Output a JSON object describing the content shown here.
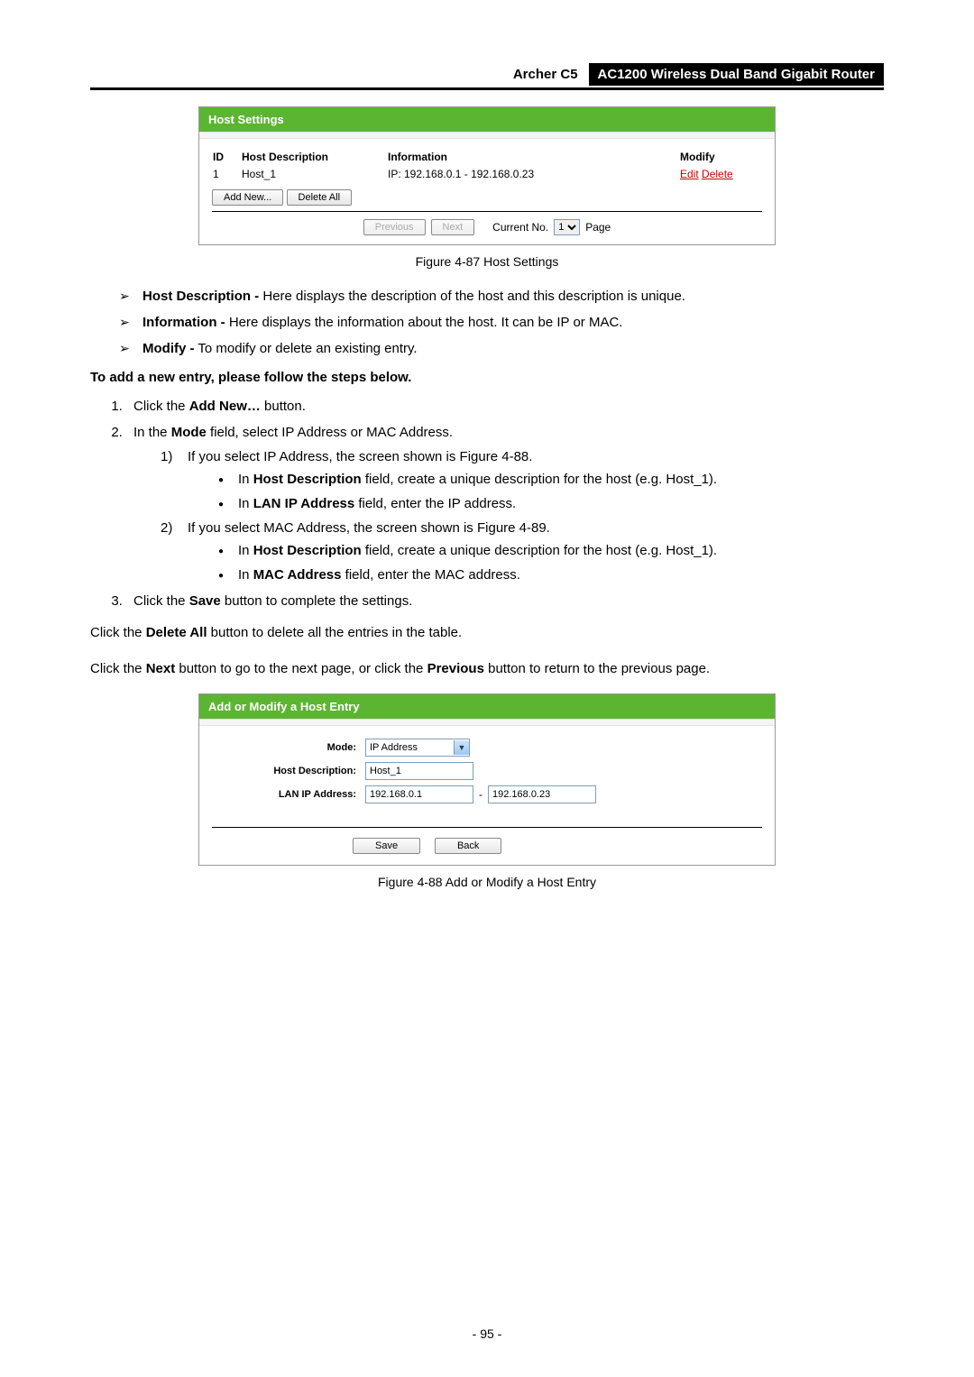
{
  "header": {
    "model": "Archer C5",
    "product": "AC1200 Wireless Dual Band Gigabit Router"
  },
  "figure1": {
    "title": "Host Settings",
    "cols": {
      "id": "ID",
      "desc": "Host Description",
      "info": "Information",
      "mod": "Modify"
    },
    "row": {
      "id": "1",
      "desc": "Host_1",
      "info": "IP: 192.168.0.1 - 192.168.0.23",
      "edit": "Edit",
      "del": "Delete"
    },
    "addnew": "Add New...",
    "deleteall": "Delete All",
    "prev": "Previous",
    "next": "Next",
    "current": "Current No.",
    "page": "Page",
    "sel": "1",
    "caption": "Figure 4-87 Host Settings"
  },
  "bullets": {
    "b1a": "Host Description -",
    "b1b": " Here displays the description of the host and this description is unique.",
    "b2a": "Information -",
    "b2b": " Here displays the information about the host. It can be IP or MAC.",
    "b3a": "Modify -",
    "b3b": " To modify or delete an existing entry."
  },
  "heading_steps": "To add a new entry, please follow the steps below.",
  "steps": {
    "s1a": "Click the ",
    "s1b": "Add New…",
    "s1c": " button.",
    "s2a": "In the ",
    "s2b": "Mode",
    "s2c": " field, select IP Address or MAC Address.",
    "s3a": "Click the ",
    "s3b": "Save",
    "s3c": " button to complete the settings."
  },
  "substeps": {
    "a": "If you select IP Address, the screen shown is Figure 4-88.",
    "a1a": "In ",
    "a1b": "Host Description",
    "a1c": " field, create a unique description for the host (e.g. Host_1).",
    "a2a": "In ",
    "a2b": "LAN IP Address",
    "a2c": " field, enter the IP address.",
    "b": "If you select MAC Address, the screen shown is Figure 4-89.",
    "b1a": "In ",
    "b1b": "Host Description",
    "b1c": " field, create a unique description for the host (e.g. Host_1).",
    "b2a": "In ",
    "b2b": "MAC Address",
    "b2c": " field, enter the MAC address."
  },
  "after": {
    "p1a": "Click the ",
    "p1b": "Delete All",
    "p1c": " button to delete all the entries in the table.",
    "p2a": "Click the ",
    "p2b": "Next",
    "p2c": " button to go to the next page, or click the ",
    "p2d": "Previous",
    "p2e": " button to return to the previous page."
  },
  "figure2": {
    "title": "Add or Modify a Host Entry",
    "labels": {
      "mode": "Mode:",
      "desc": "Host Description:",
      "ip": "LAN IP Address:"
    },
    "vals": {
      "mode": "IP Address",
      "desc": "Host_1",
      "ip1": "192.168.0.1",
      "dash": "-",
      "ip2": "192.168.0.23"
    },
    "save": "Save",
    "back": "Back",
    "caption": "Figure 4-88 Add or Modify a Host Entry"
  },
  "pagenum": "- 95 -"
}
